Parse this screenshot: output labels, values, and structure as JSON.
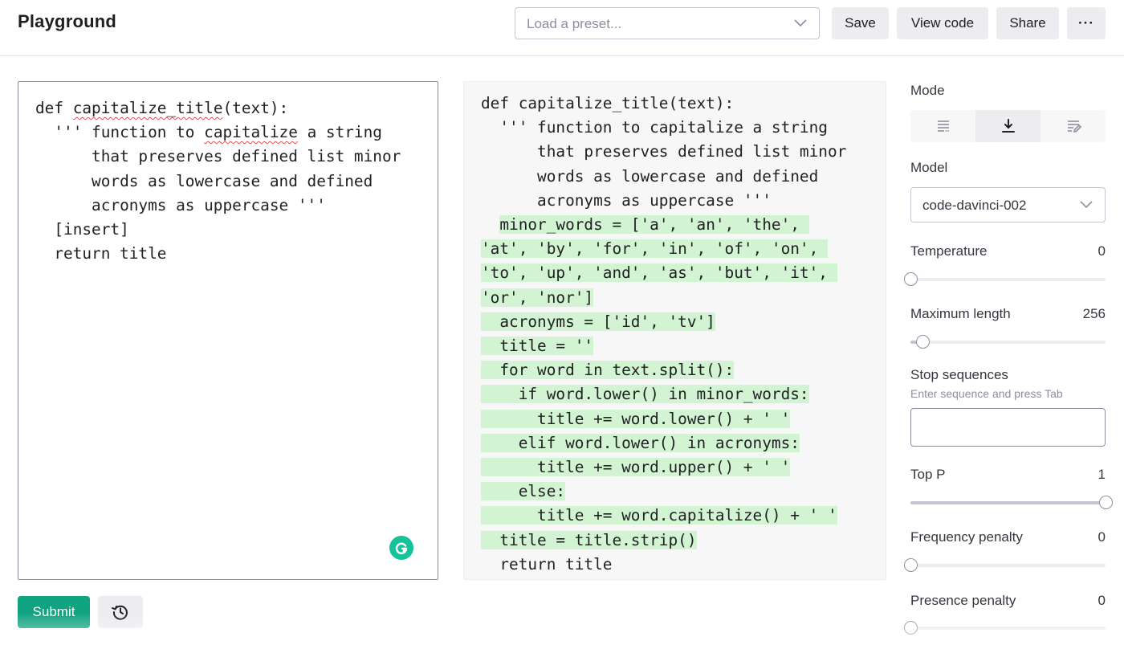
{
  "header": {
    "title": "Playground",
    "preset_placeholder": "Load a preset...",
    "save_label": "Save",
    "view_code_label": "View code",
    "share_label": "Share",
    "more_label": "···"
  },
  "prompt_lines": [
    [
      "def ",
      {
        "t": "capitalize_title",
        "spell": true
      },
      "(text):"
    ],
    [
      "  ''' function to ",
      {
        "t": "capitalize",
        "spell": true
      },
      " a string"
    ],
    [
      "      that preserves defined list minor"
    ],
    [
      "      words as lowercase and defined"
    ],
    [
      "      acronyms as uppercase '''"
    ],
    [
      "  [insert]"
    ],
    [
      "  return title"
    ]
  ],
  "output_lines": [
    {
      "pre": "def capitalize_title(text):",
      "hl": ""
    },
    {
      "pre": "  ''' function to capitalize a string",
      "hl": ""
    },
    {
      "pre": "      that preserves defined list minor",
      "hl": ""
    },
    {
      "pre": "      words as lowercase and defined",
      "hl": ""
    },
    {
      "pre": "      acronyms as uppercase '''",
      "hl": ""
    },
    {
      "pre": "  ",
      "hl": "minor_words = ['a', 'an', 'the', "
    },
    {
      "pre": "",
      "hl": "'at', 'by', 'for', 'in', 'of', 'on', "
    },
    {
      "pre": "",
      "hl": "'to', 'up', 'and', 'as', 'but', 'it', "
    },
    {
      "pre": "",
      "hl": "'or', 'nor']"
    },
    {
      "pre": "",
      "hl": "  acronyms = ['id', 'tv']"
    },
    {
      "pre": "",
      "hl": "  title = ''"
    },
    {
      "pre": "",
      "hl": "  for word in text.split():"
    },
    {
      "pre": "",
      "hl": "    if word.lower() in minor_words:"
    },
    {
      "pre": "",
      "hl": "      title += word.lower() + ' '"
    },
    {
      "pre": "",
      "hl": "    elif word.lower() in acronyms:"
    },
    {
      "pre": "",
      "hl": "      title += word.upper() + ' '"
    },
    {
      "pre": "",
      "hl": "    else:"
    },
    {
      "pre": "",
      "hl": "      title += word.capitalize() + ' '"
    },
    {
      "pre": "",
      "hl": "  title = title.strip()"
    },
    {
      "pre": "  return title",
      "hl": ""
    }
  ],
  "actions": {
    "submit_label": "Submit"
  },
  "settings": {
    "mode_label": "Mode",
    "modes": [
      "complete",
      "insert",
      "edit"
    ],
    "active_mode": "insert",
    "model_label": "Model",
    "model_value": "code-davinci-002",
    "temperature": {
      "label": "Temperature",
      "value": "0",
      "fraction": 0
    },
    "max_length": {
      "label": "Maximum length",
      "value": "256",
      "fraction": 0.063
    },
    "stop_sequences": {
      "label": "Stop sequences",
      "hint": "Enter sequence and press Tab"
    },
    "top_p": {
      "label": "Top P",
      "value": "1",
      "fraction": 1
    },
    "frequency_penalty": {
      "label": "Frequency penalty",
      "value": "0",
      "fraction": 0
    },
    "presence_penalty": {
      "label": "Presence penalty",
      "value": "0",
      "fraction": 0
    }
  },
  "colors": {
    "accent": "#10a37f",
    "highlight": "#d2f4d3",
    "grammarly": "#15c39a"
  }
}
